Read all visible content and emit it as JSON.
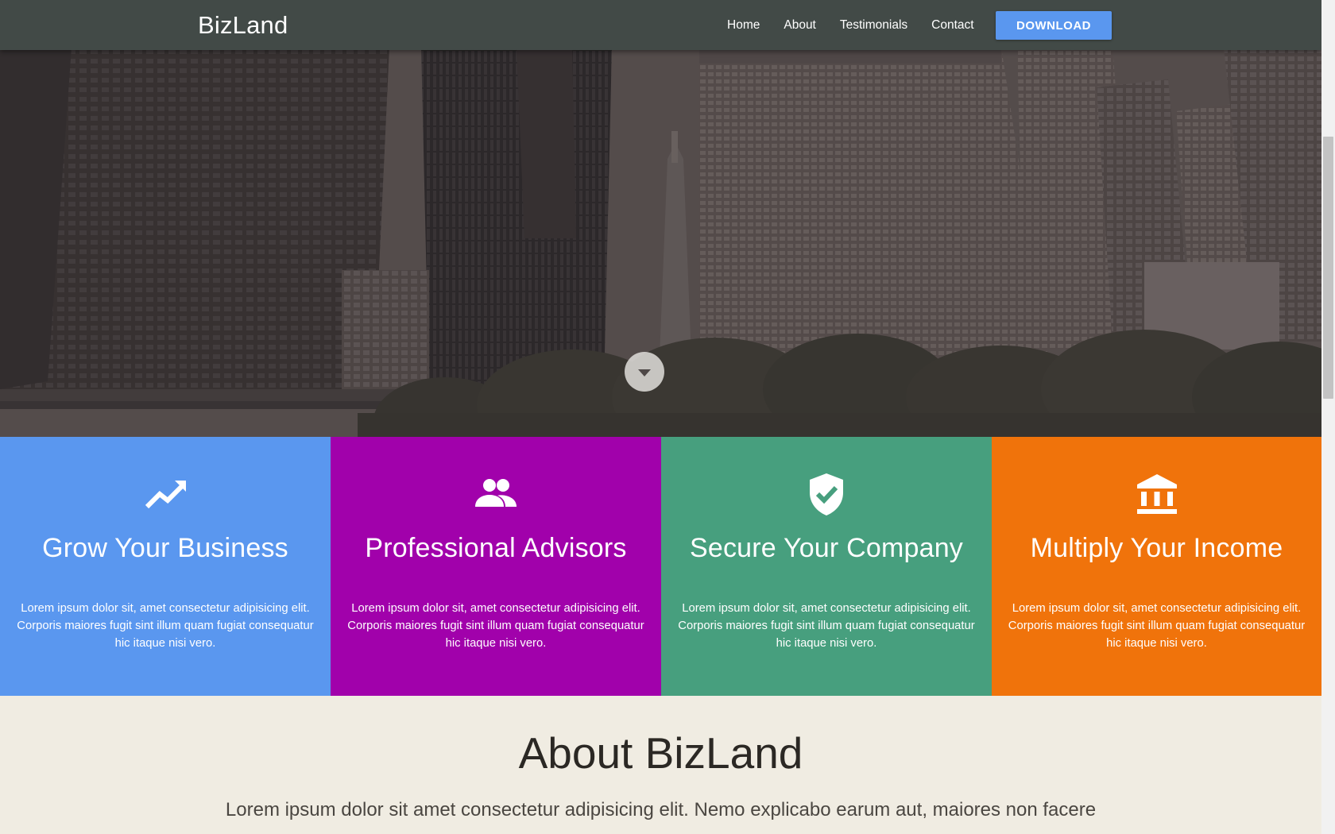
{
  "header": {
    "brand": "BizLand",
    "nav": [
      "Home",
      "About",
      "Testimonials",
      "Contact"
    ],
    "download_label": "DOWNLOAD"
  },
  "hero": {
    "scroll_icon": "chevron-down-icon"
  },
  "features": [
    {
      "icon": "trending-up-icon",
      "title": "Grow Your Business",
      "text": "Lorem ipsum dolor sit, amet consectetur adipisicing elit. Corporis maiores fugit sint illum quam fugiat consequatur hic itaque nisi vero.",
      "color": "#5a97ef"
    },
    {
      "icon": "people-icon",
      "title": "Professional Advisors",
      "text": "Lorem ipsum dolor sit, amet consectetur adipisicing elit. Corporis maiores fugit sint illum quam fugiat consequatur hic itaque nisi vero.",
      "color": "#a101ab"
    },
    {
      "icon": "verified-shield-icon",
      "title": "Secure Your Company",
      "text": "Lorem ipsum dolor sit, amet consectetur adipisicing elit. Corporis maiores fugit sint illum quam fugiat consequatur hic itaque nisi vero.",
      "color": "#479f7e"
    },
    {
      "icon": "bank-icon",
      "title": "Multiply Your Income",
      "text": "Lorem ipsum dolor sit, amet consectetur adipisicing elit. Corporis maiores fugit sint illum quam fugiat consequatur hic itaque nisi vero.",
      "color": "#f0730b"
    }
  ],
  "about": {
    "title": "About BizLand",
    "text": "Lorem ipsum dolor sit amet consectetur adipisicing elit. Nemo explicabo earum aut, maiores non facere"
  },
  "colors": {
    "navbar": "#424a47",
    "accent": "#5a97ef",
    "page_background": "#f0ece2"
  }
}
